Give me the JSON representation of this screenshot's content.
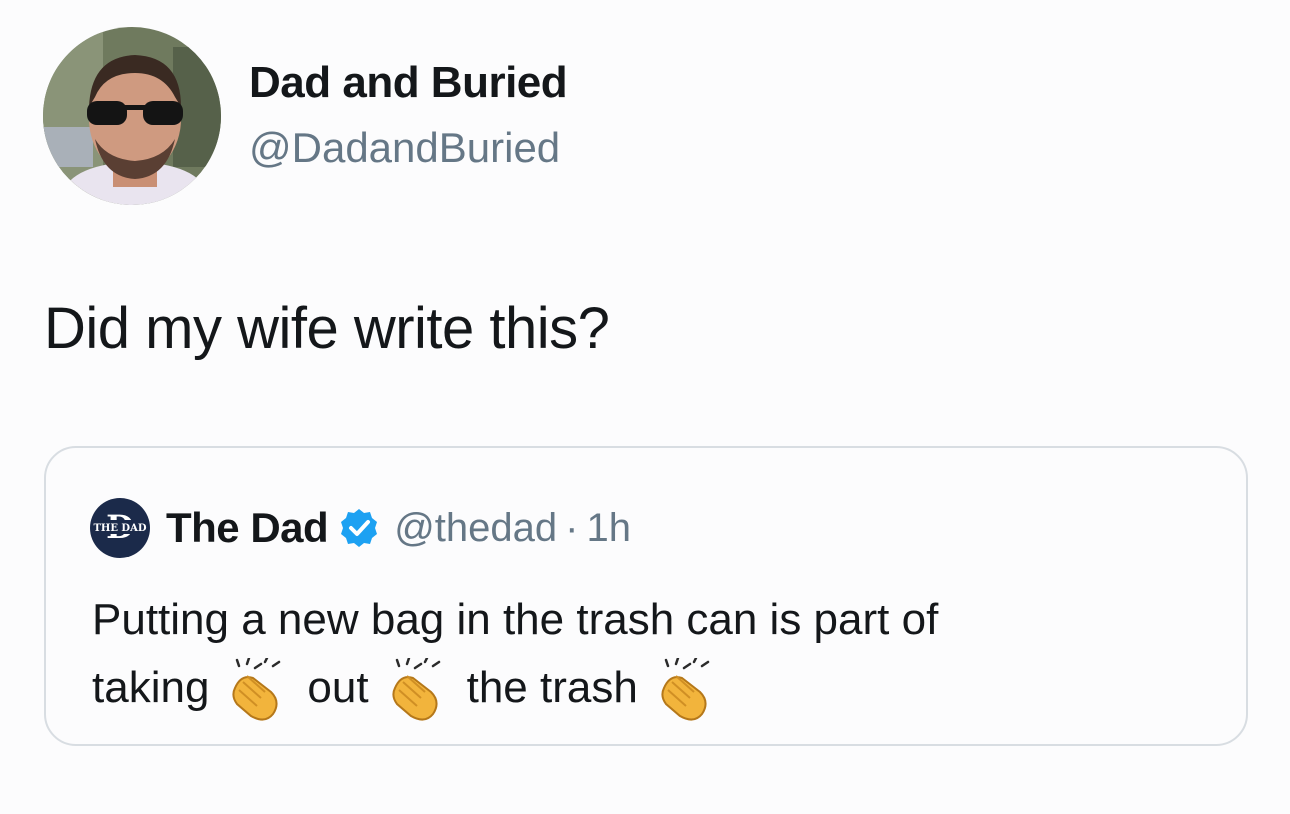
{
  "tweet": {
    "author_name": "Dad and Buried",
    "author_handle": "@DadandBuried",
    "text": "Did my wife write this?"
  },
  "quoted_tweet": {
    "logo_text": "THE DAD",
    "author_name": "The Dad",
    "verified_icon": "verified-badge-icon",
    "author_handle": "@thedad",
    "separator": "·",
    "time": "1h",
    "line1": "Putting a new bag in the trash can is part of",
    "line2_parts": [
      "taking",
      "out",
      "the trash"
    ],
    "emoji": "clapping-hands"
  },
  "colors": {
    "text": "#14171a",
    "muted": "#657786",
    "verified_blue": "#1da1f2",
    "border": "#d8dde2"
  }
}
